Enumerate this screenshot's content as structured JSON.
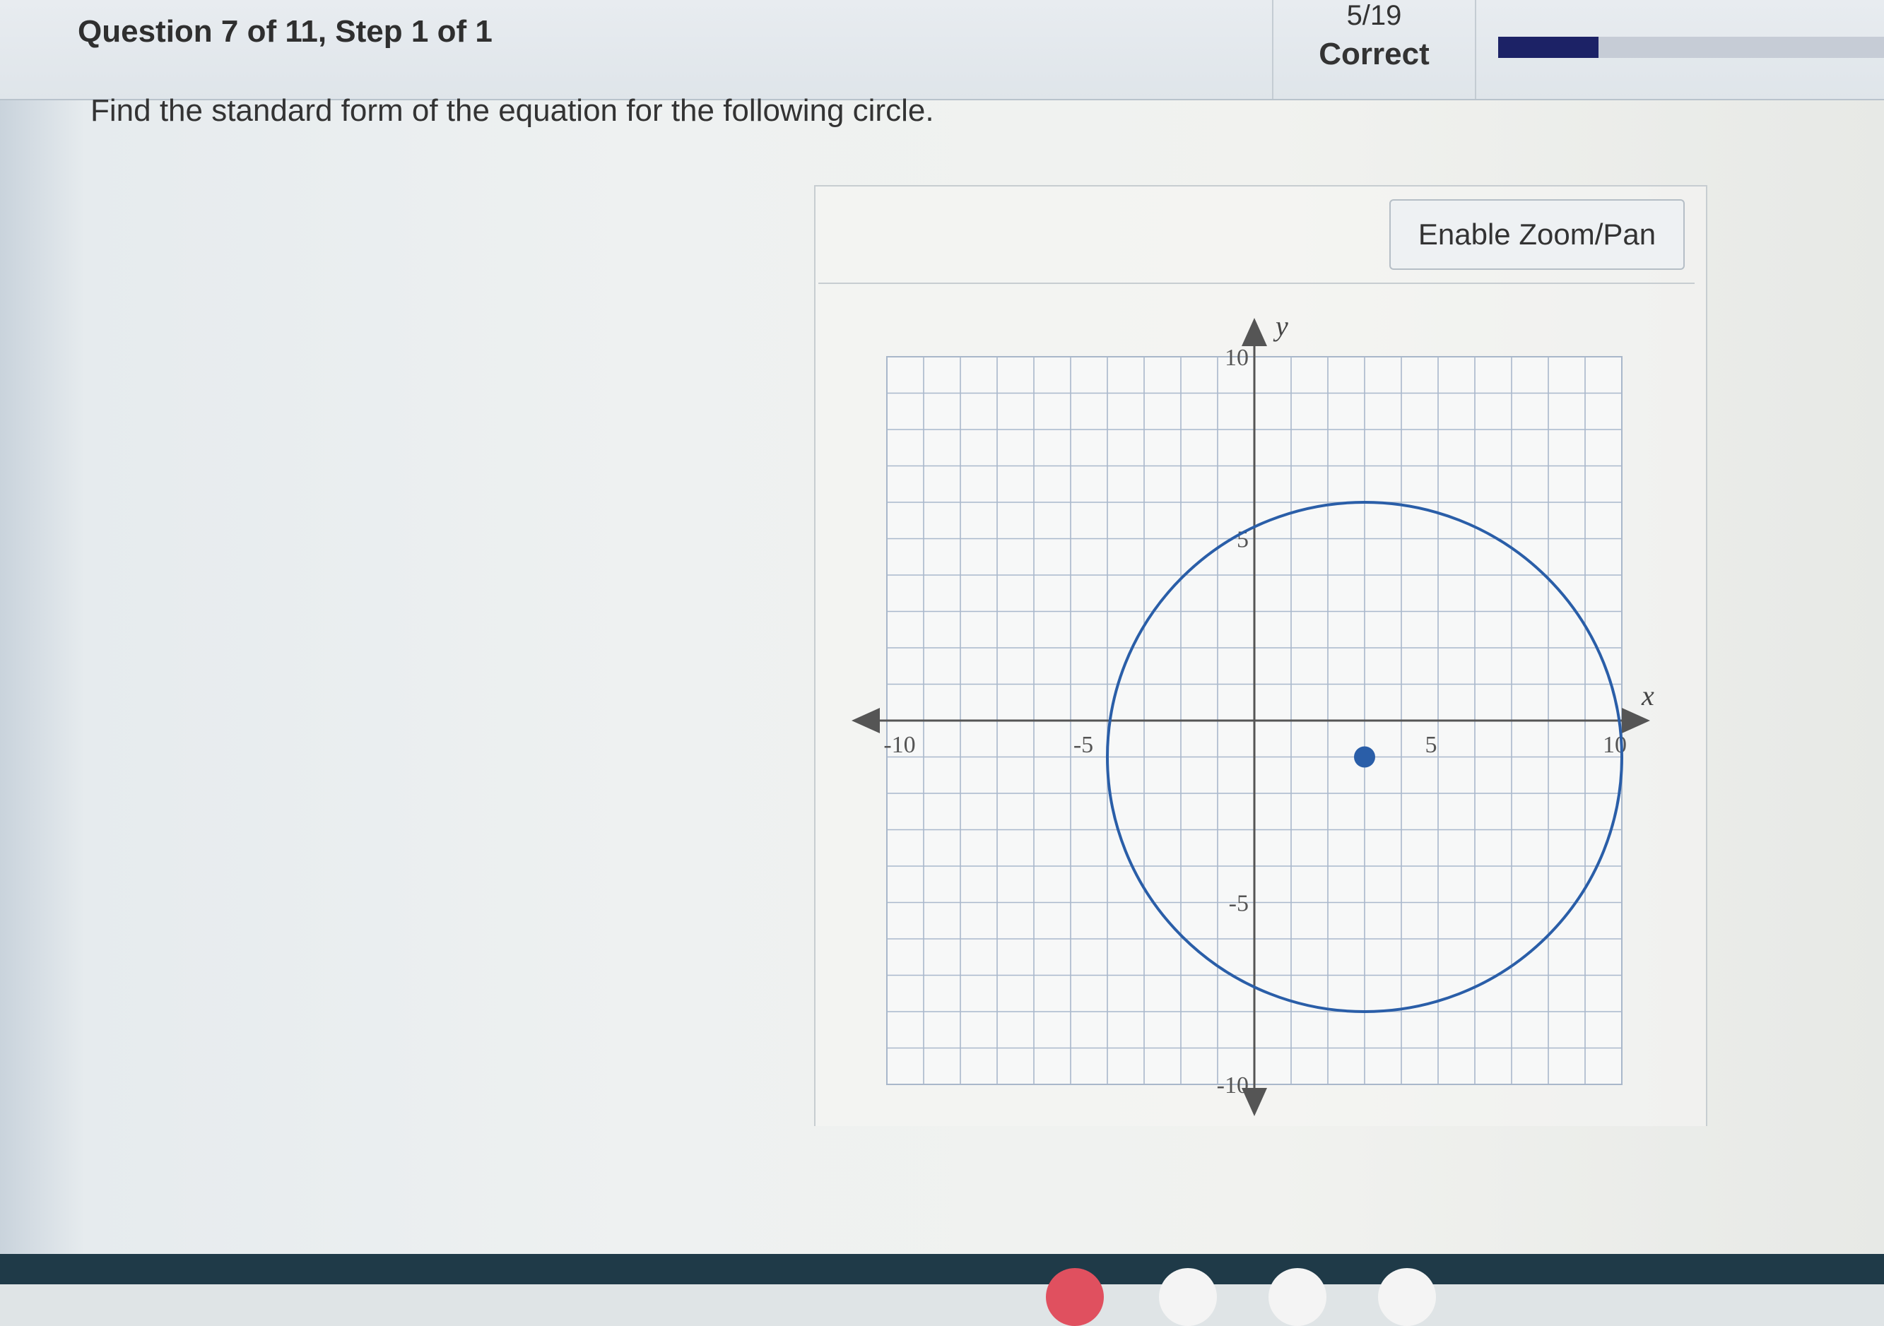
{
  "header": {
    "question_title": "Question 7 of 11, Step 1 of 1",
    "score_count": "5/19",
    "score_label": "Correct",
    "progress_fraction": 0.26,
    "progress_color": "#1c2266"
  },
  "question": {
    "prompt": "Find the standard form of the equation for the following circle."
  },
  "graph_panel": {
    "zoom_button_label": "Enable Zoom/Pan"
  },
  "chart_data": {
    "type": "scatter",
    "xlabel": "x",
    "ylabel": "y",
    "xlim": [
      -10,
      10
    ],
    "ylim": [
      -10,
      10
    ],
    "grid": true,
    "x_tick_labels": [
      "-10",
      "-5",
      "5",
      "10"
    ],
    "y_tick_labels": [
      "10",
      "5",
      "-5",
      "-10"
    ],
    "circle": {
      "center": [
        3,
        -1
      ],
      "radius": 7,
      "color": "#2a5ea8"
    },
    "points": [
      {
        "x": 3,
        "y": -1,
        "color": "#2a5ea8"
      }
    ]
  },
  "taskbar": {
    "icons": [
      "app-icon-red",
      "app-icon-white-1",
      "app-icon-white-2",
      "app-icon-white-3"
    ]
  }
}
